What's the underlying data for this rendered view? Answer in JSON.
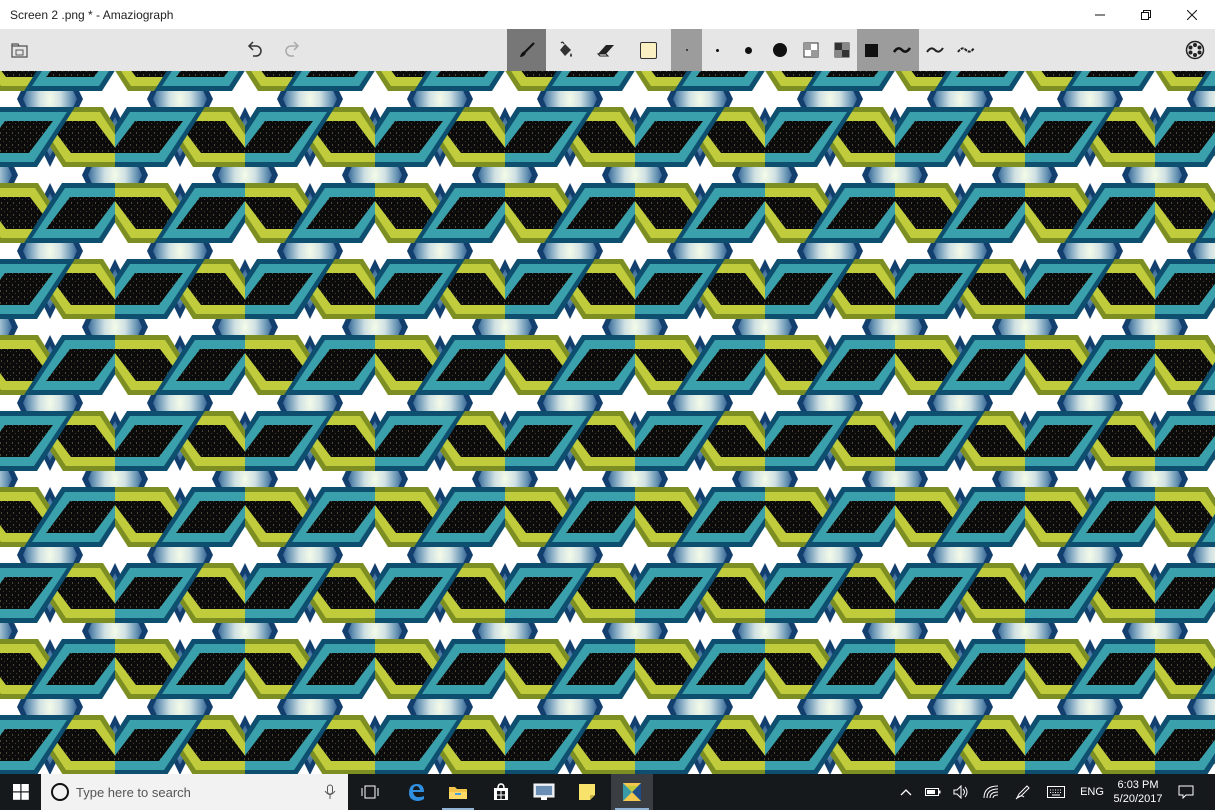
{
  "window": {
    "title": "Screen 2 .png * - Amaziograph",
    "controls": [
      "minimize",
      "maximize",
      "close"
    ]
  },
  "toolbar": {
    "left_icons": [
      "gallery-icon",
      "undo-icon",
      "redo-icon"
    ],
    "tools": [
      "brush-icon",
      "fill-bucket-icon",
      "eraser-icon"
    ],
    "current_color": "#fbf0c2",
    "brush_sizes": [
      "smallest",
      "small",
      "medium",
      "large"
    ],
    "opacity_options": [
      "opacity-low",
      "opacity-high"
    ],
    "stroke_styles": [
      "solid",
      "smooth",
      "sketch-1",
      "sketch-2"
    ],
    "right_icon": "symmetry-icon",
    "selected_tool": "brush",
    "selected_size": "smallest",
    "selected_style": "solid-smooth"
  },
  "canvas": {
    "pattern_colors": {
      "yellow_green": "#b9c43a",
      "teal": "#3a9ba8",
      "navy": "#0d3f70",
      "dark_center": "#0b0b0b",
      "light_center": "#eaf3e2"
    }
  },
  "taskbar": {
    "search_placeholder": "Type here to search",
    "apps": [
      "task-view-icon",
      "edge-icon",
      "file-explorer-icon",
      "store-icon",
      "remote-desktop-icon",
      "sticky-notes-icon",
      "amaziograph-icon"
    ],
    "tray_icons": [
      "chevron-up-icon",
      "battery-icon",
      "volume-icon",
      "wifi-icon",
      "pen-icon",
      "keyboard-icon"
    ],
    "language": "ENG",
    "time": "6:03 PM",
    "date": "5/20/2017"
  }
}
